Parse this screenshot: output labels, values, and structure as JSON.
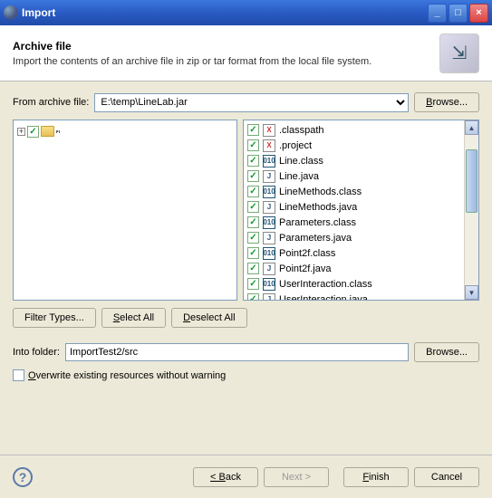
{
  "window": {
    "title": "Import"
  },
  "header": {
    "title": "Archive file",
    "desc": "Import the contents of an archive file in zip or tar format from the local file system."
  },
  "fromArchive": {
    "label": "From archive file:",
    "value": "E:\\temp\\LineLab.jar",
    "browse": "Browse..."
  },
  "tree": {
    "root": ""
  },
  "files": [
    {
      "name": ".classpath",
      "icon": "X"
    },
    {
      "name": ".project",
      "icon": "X"
    },
    {
      "name": "Line.class",
      "icon": "010"
    },
    {
      "name": "Line.java",
      "icon": "J"
    },
    {
      "name": "LineMethods.class",
      "icon": "010"
    },
    {
      "name": "LineMethods.java",
      "icon": "J"
    },
    {
      "name": "Parameters.class",
      "icon": "010"
    },
    {
      "name": "Parameters.java",
      "icon": "J"
    },
    {
      "name": "Point2f.class",
      "icon": "010"
    },
    {
      "name": "Point2f.java",
      "icon": "J"
    },
    {
      "name": "UserInteraction.class",
      "icon": "010"
    },
    {
      "name": "UserInteraction.java",
      "icon": "J"
    }
  ],
  "buttons": {
    "filterTypes": "Filter Types...",
    "selectAll": "Select All",
    "deselectAll": "Deselect All"
  },
  "intoFolder": {
    "label": "Into folder:",
    "value": "ImportTest2/src",
    "browse": "Browse..."
  },
  "overwrite": {
    "label": "Overwrite existing resources without warning",
    "checked": false
  },
  "footer": {
    "back": "< Back",
    "next": "Next >",
    "finish": "Finish",
    "cancel": "Cancel"
  }
}
